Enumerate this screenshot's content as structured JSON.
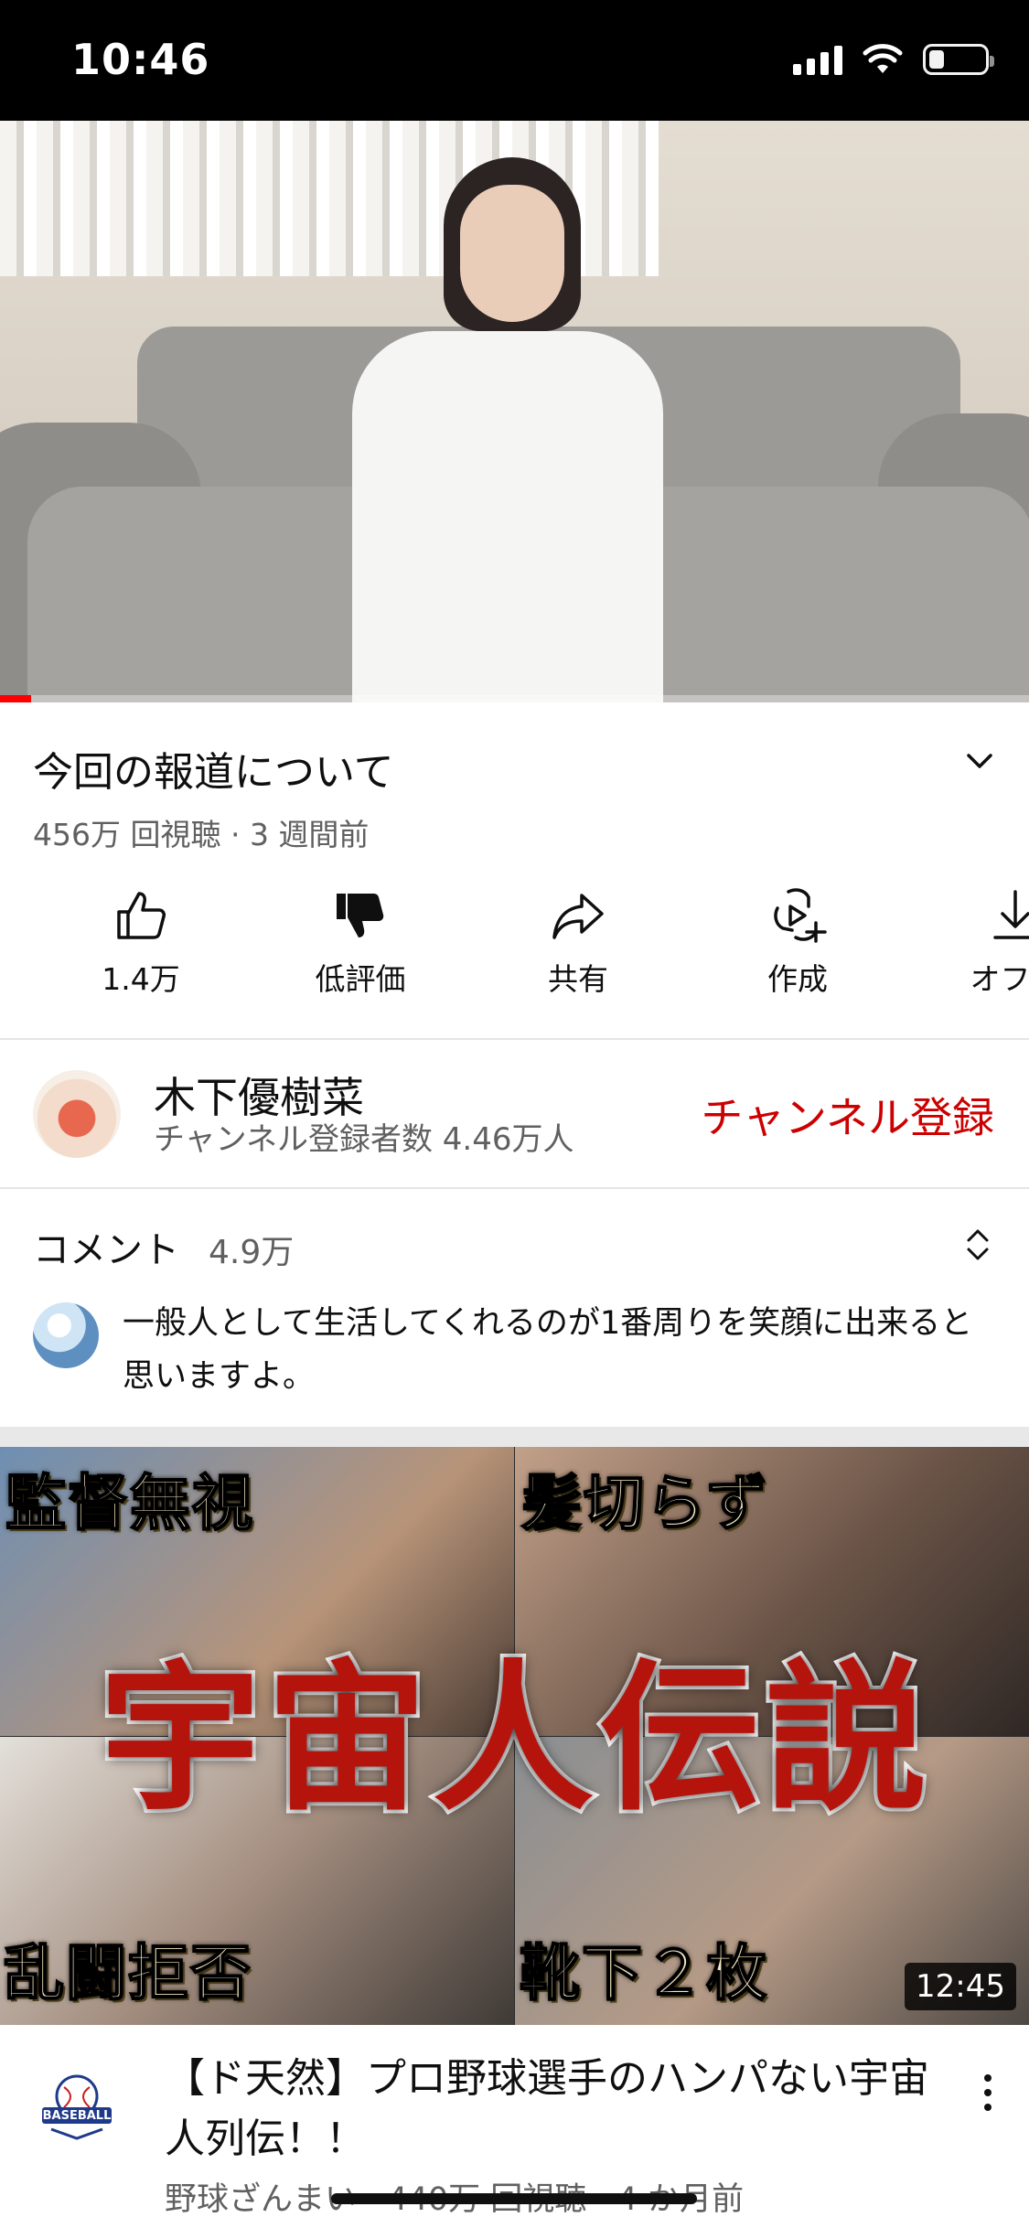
{
  "status_bar": {
    "time": "10:46"
  },
  "video": {
    "title": "今回の報道について",
    "meta": "456万 回視聴 · 3 週間前",
    "progress": 0.03
  },
  "actions": [
    {
      "label": "1.4万",
      "icon": "thumbs-up-icon"
    },
    {
      "label": "低評価",
      "icon": "thumbs-down-icon"
    },
    {
      "label": "共有",
      "icon": "share-icon"
    },
    {
      "label": "作成",
      "icon": "create-icon"
    },
    {
      "label": "オフラ",
      "icon": "download-icon"
    }
  ],
  "channel": {
    "name": "木下優樹菜",
    "subscribers": "チャンネル登録者数 4.46万人",
    "subscribe_label": "チャンネル登録"
  },
  "comments": {
    "heading": "コメント",
    "count": "4.9万",
    "top_comment": "一般人として生活してくれるのが1番周りを笑顔に出来ると思いますよ。"
  },
  "next_video": {
    "thumbnail": {
      "headline": "宇宙人伝説",
      "corner_top_left": "監督無視",
      "corner_top_right": "髪切らず",
      "corner_bottom_left": "乱闘拒否",
      "corner_bottom_right": "靴下２枚"
    },
    "duration": "12:45",
    "title": "【ド天然】プロ野球選手のハンパない宇宙人列伝！！",
    "meta": "野球ざんまい · 440万 回視聴 · 4 か月前",
    "channel_logo_text": "BASEBALL"
  },
  "colors": {
    "accent_red": "#cc0000",
    "progress_red": "#ff0000",
    "secondary_text": "#606060"
  }
}
